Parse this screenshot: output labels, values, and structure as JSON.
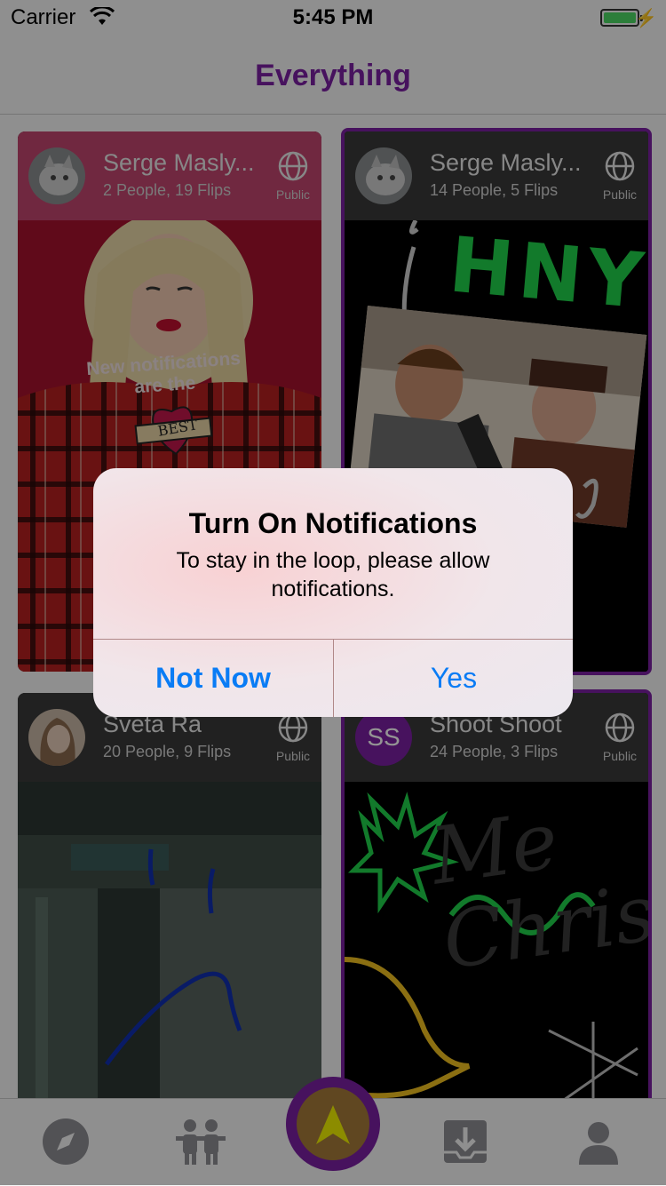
{
  "status_bar": {
    "carrier": "Carrier",
    "time": "5:45 PM"
  },
  "nav": {
    "title": "Everything"
  },
  "cards": [
    {
      "name": "Serge Masly...",
      "subtitle": "2 People, 19 Flips",
      "visibility": "Public",
      "caption_line1": "New notifications",
      "caption_line2": "are the",
      "badge": "BEST"
    },
    {
      "name": "Serge Masly...",
      "subtitle": "14 People, 5 Flips",
      "visibility": "Public",
      "overlay_text": "HNY"
    },
    {
      "name": "Sveta Ra",
      "subtitle": "20 People, 9 Flips",
      "visibility": "Public"
    },
    {
      "name": "Shoot Shoot",
      "subtitle": "24 People, 3 Flips",
      "visibility": "Public",
      "initials": "SS",
      "overlay_text": "Me Chris"
    }
  ],
  "tabbar": {
    "items": [
      "compass-icon",
      "people-icon",
      "create-icon",
      "inbox-download-icon",
      "profile-icon"
    ]
  },
  "alert": {
    "title": "Turn On Notifications",
    "message": "To stay in the loop, please allow notifications.",
    "cancel_label": "Not Now",
    "confirm_label": "Yes"
  },
  "colors": {
    "accent": "#7b1fa2",
    "button_blue": "#0a7cf5"
  }
}
